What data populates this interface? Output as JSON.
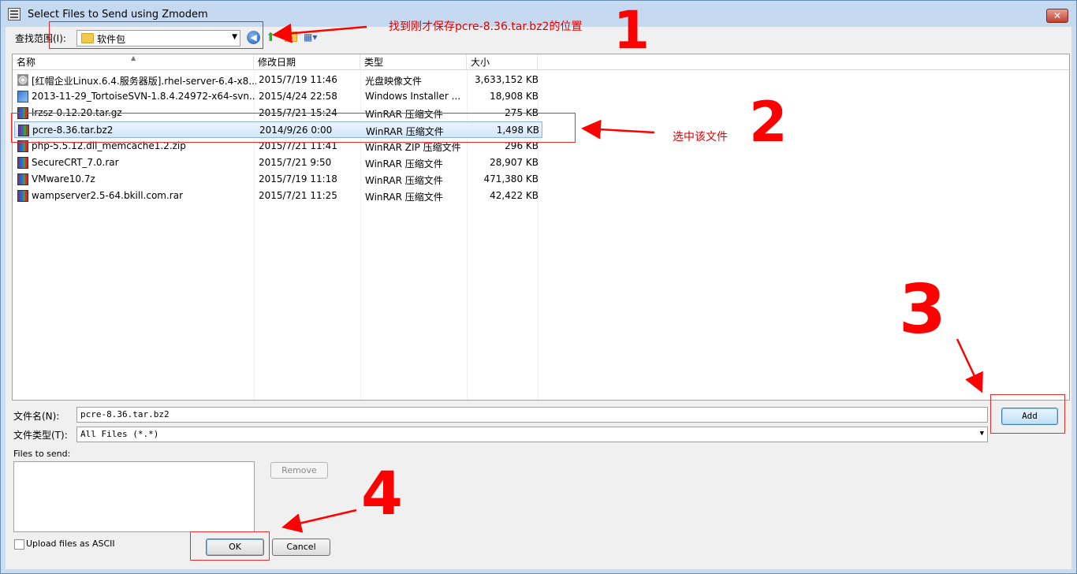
{
  "window": {
    "title": "Select Files to Send using Zmodem",
    "close_label": "✕"
  },
  "lookin": {
    "label": "查找范围(I):",
    "value": "软件包"
  },
  "columns": {
    "name": "名称",
    "date": "修改日期",
    "type": "类型",
    "size": "大小"
  },
  "files": [
    {
      "name": "[红帽企业Linux.6.4.服务器版].rhel-server-6.4-x8...",
      "date": "2015/7/19 11:46",
      "type": "光盘映像文件",
      "size": "3,633,152 KB",
      "icon": "disc-image-icon"
    },
    {
      "name": "2013-11-29_TortoiseSVN-1.8.4.24972-x64-svn...",
      "date": "2015/4/24 22:58",
      "type": "Windows Installer ...",
      "size": "18,908 KB",
      "icon": "installer-icon"
    },
    {
      "name": "lrzsz-0.12.20.tar.gz",
      "date": "2015/7/21 15:24",
      "type": "WinRAR 压缩文件",
      "size": "275 KB",
      "icon": "winrar-archive-icon"
    },
    {
      "name": "pcre-8.36.tar.bz2",
      "date": "2014/9/26 0:00",
      "type": "WinRAR 压缩文件",
      "size": "1,498 KB",
      "icon": "winrar-archive-icon"
    },
    {
      "name": "php-5.5.12.dll_memcache1.2.zip",
      "date": "2015/7/21 11:41",
      "type": "WinRAR ZIP 压缩文件",
      "size": "296 KB",
      "icon": "winrar-zip-icon"
    },
    {
      "name": "SecureCRT_7.0.rar",
      "date": "2015/7/21 9:50",
      "type": "WinRAR 压缩文件",
      "size": "28,907 KB",
      "icon": "winrar-archive-icon"
    },
    {
      "name": "VMware10.7z",
      "date": "2015/7/19 11:18",
      "type": "WinRAR 压缩文件",
      "size": "471,380 KB",
      "icon": "winrar-archive-icon"
    },
    {
      "name": "wampserver2.5-64.bkill.com.rar",
      "date": "2015/7/21 11:25",
      "type": "WinRAR 压缩文件",
      "size": "42,422 KB",
      "icon": "winrar-archive-icon"
    }
  ],
  "selected_index": 3,
  "filename": {
    "label": "文件名(N):",
    "value": "pcre-8.36.tar.bz2"
  },
  "filetype": {
    "label": "文件类型(T):",
    "value": "All Files (*.*)"
  },
  "buttons": {
    "add": "Add",
    "remove": "Remove",
    "ok": "OK",
    "cancel": "Cancel"
  },
  "files_to_send": {
    "label": "Files to send:"
  },
  "ascii": {
    "label": "Upload files as ASCII",
    "checked": false
  },
  "annotations": {
    "note1": "找到刚才保存pcre-8.36.tar.bz2的位置",
    "note2": "选中该文件",
    "num1": "1",
    "num2": "2",
    "num3": "3",
    "num4": "4",
    "color": "#ff0000"
  },
  "colors": {
    "selection": "#d3e6fa",
    "default_button_border": "#3c7fb1"
  }
}
